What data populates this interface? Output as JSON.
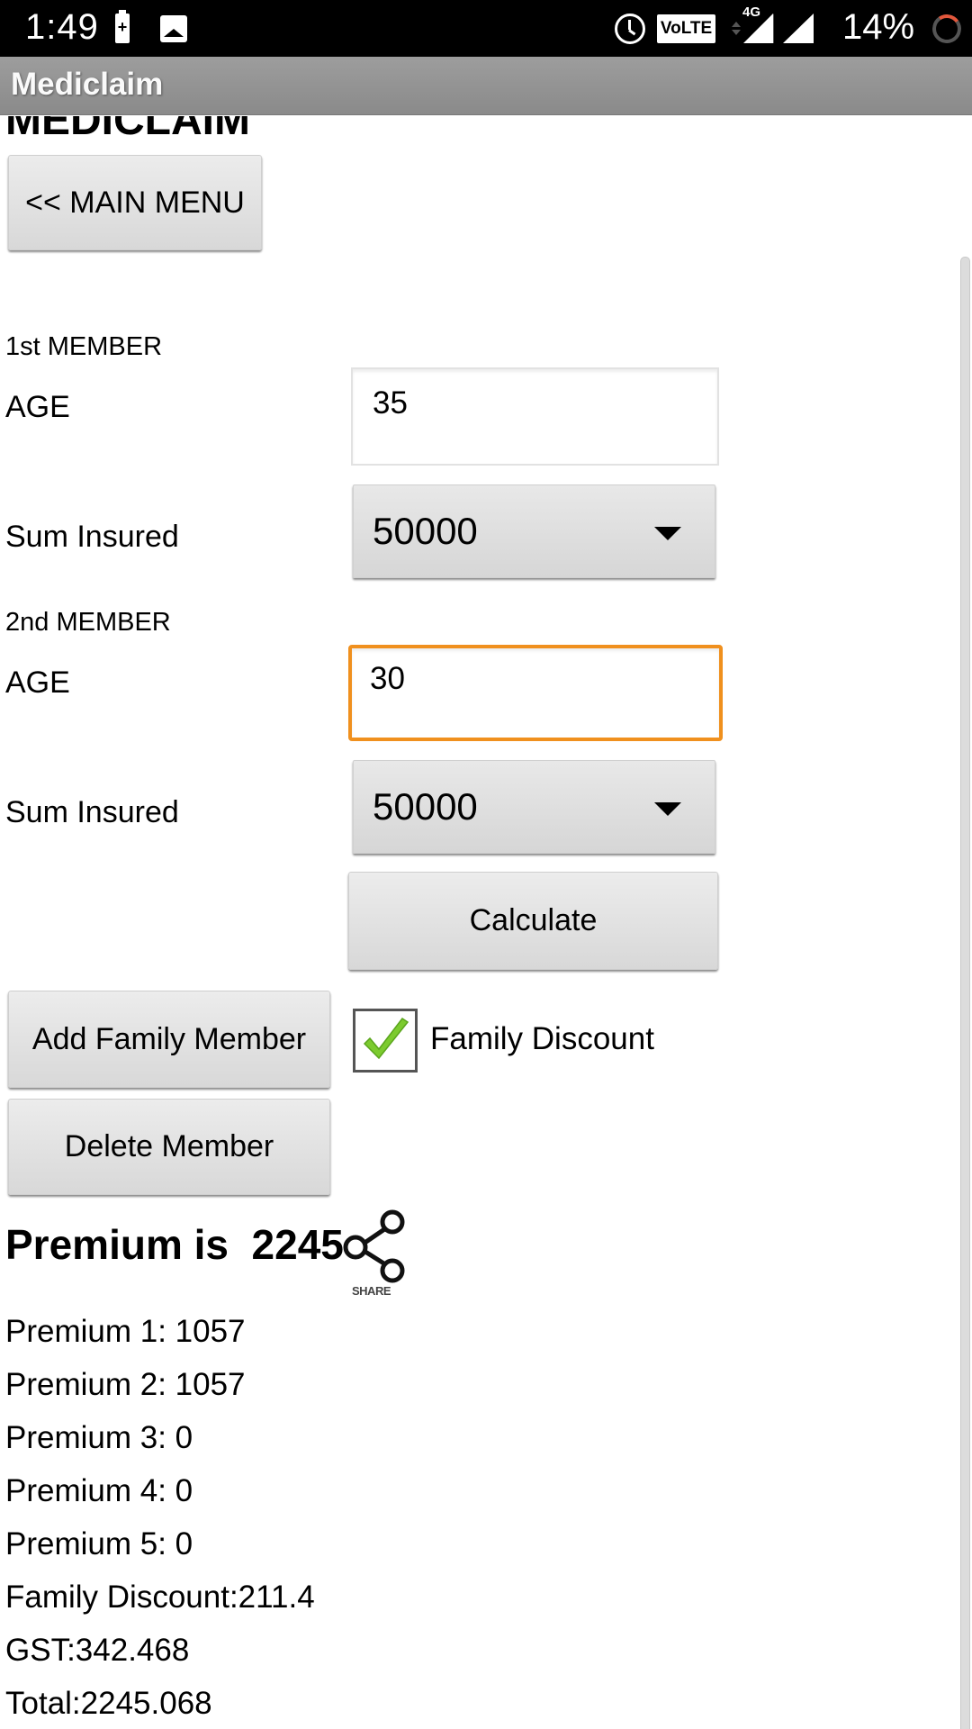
{
  "status_bar": {
    "time": "1:49",
    "volte": "VoLTE",
    "network": "4G",
    "battery_percent": "14%",
    "icons": [
      "battery-charging-icon",
      "image-icon",
      "alarm-icon",
      "volte-icon",
      "signal-4g-icon",
      "signal-icon",
      "battery-ring-icon"
    ]
  },
  "app": {
    "title": "Mediclaim",
    "heading": "MEDICLAIM"
  },
  "main_menu_button": "<< MAIN MENU",
  "members": [
    {
      "header": "1st MEMBER",
      "age_label": "AGE",
      "age_value": "35",
      "sum_label": "Sum Insured",
      "sum_value": "50000"
    },
    {
      "header": "2nd MEMBER",
      "age_label": "AGE",
      "age_value": "30",
      "sum_label": "Sum Insured",
      "sum_value": "50000"
    }
  ],
  "buttons": {
    "calculate": "Calculate",
    "add_member": "Add Family Member",
    "delete_member": "Delete Member"
  },
  "family_discount": {
    "label": "Family Discount",
    "checked": true
  },
  "result": {
    "premium_title": "Premium is  2245",
    "share_label": "SHARE",
    "lines": [
      "Premium 1: 1057",
      "Premium 2: 1057",
      "Premium 3: 0",
      "Premium 4: 0",
      "Premium 5: 0",
      "Family Discount:211.4",
      "GST:342.468",
      "Total:2245.068"
    ]
  },
  "colors": {
    "focus_border": "#f0901e",
    "check_green": "#7ccb2f",
    "titlebar": "#939393"
  }
}
